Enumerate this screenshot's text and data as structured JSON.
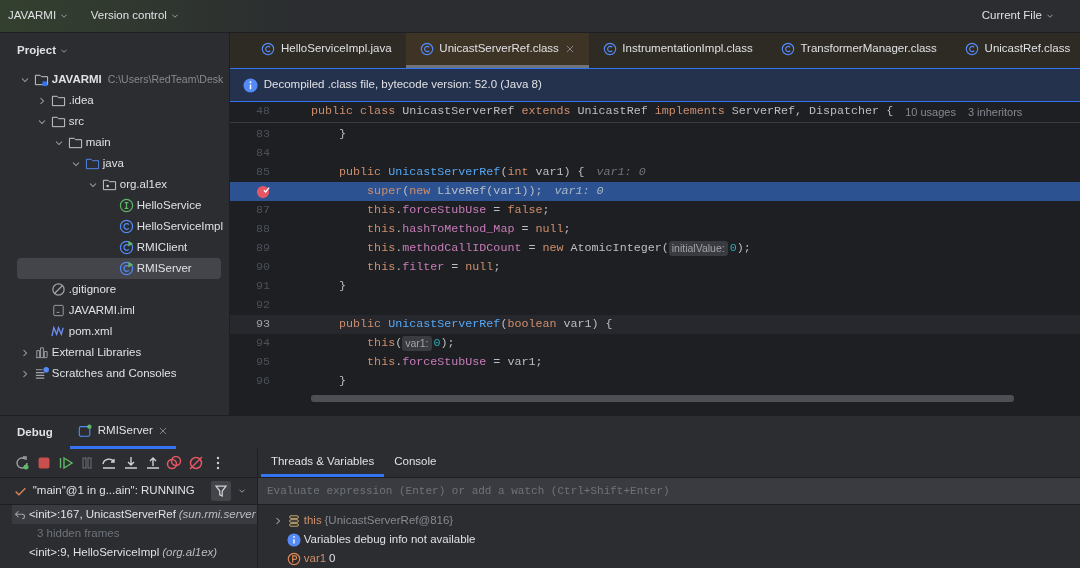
{
  "title_bar": {
    "project": "JAVARMI",
    "vcs": "Version control",
    "run_config": "Current File"
  },
  "project_panel": {
    "title": "Project",
    "tree": [
      {
        "label": "JAVARMI",
        "path": "C:\\Users\\RedTeam\\Desk",
        "kind": "project",
        "expanded": true,
        "selected": false,
        "children": [
          {
            "label": ".idea",
            "kind": "folder",
            "expanded": false,
            "selected": false
          },
          {
            "label": "src",
            "kind": "folder",
            "expanded": true,
            "selected": false,
            "children": [
              {
                "label": "main",
                "kind": "folder",
                "expanded": true,
                "selected": false,
                "children": [
                  {
                    "label": "java",
                    "kind": "source",
                    "expanded": true,
                    "selected": false,
                    "children": [
                      {
                        "label": "org.al1ex",
                        "kind": "package",
                        "expanded": true,
                        "selected": false,
                        "children": [
                          {
                            "label": "HelloService",
                            "kind": "interface",
                            "selected": false
                          },
                          {
                            "label": "HelloServiceImpl",
                            "kind": "class",
                            "selected": false
                          },
                          {
                            "label": "RMIClient",
                            "kind": "runnable",
                            "selected": false
                          },
                          {
                            "label": "RMIServer",
                            "kind": "runnable",
                            "selected": true
                          }
                        ]
                      }
                    ]
                  }
                ]
              }
            ]
          },
          {
            "label": ".gitignore",
            "kind": "ignore",
            "selected": false
          },
          {
            "label": "JAVARMI.iml",
            "kind": "iml",
            "selected": false
          },
          {
            "label": "pom.xml",
            "kind": "maven",
            "selected": false
          }
        ]
      },
      {
        "label": "External Libraries",
        "kind": "libraries",
        "expanded": false,
        "selected": false
      },
      {
        "label": "Scratches and Consoles",
        "kind": "scratches",
        "expanded": false,
        "selected": false
      }
    ]
  },
  "editor_tabs": [
    {
      "label": "HelloServiceImpl.java",
      "selected": false
    },
    {
      "label": "UnicastServerRef.class",
      "selected": true
    },
    {
      "label": "InstrumentationImpl.class",
      "selected": false
    },
    {
      "label": "TransformerManager.class",
      "selected": false
    },
    {
      "label": "UnicastRef.class",
      "selected": false
    }
  ],
  "banner": "Decompiled .class file, bytecode version: 52.0 (Java 8)",
  "sticky_line": {
    "number": "48",
    "parts": [
      {
        "kind": "code",
        "tokens": [
          {
            "text": "public class ",
            "kind": "kw"
          },
          {
            "text": "UnicastServerRef ",
            "kind": "plain"
          },
          {
            "text": "extends ",
            "kind": "kw"
          },
          {
            "text": "UnicastRef ",
            "kind": "plain"
          },
          {
            "text": "implements ",
            "kind": "kw"
          },
          {
            "text": "ServerRef, Dispatcher {",
            "kind": "plain"
          }
        ]
      },
      {
        "kind": "lens",
        "text": "10 usages"
      },
      {
        "kind": "lens",
        "text": "3 inheritors"
      }
    ]
  },
  "code_lines": [
    {
      "number": "83",
      "current": false,
      "caret": false,
      "breakpoint": false,
      "parts": [
        {
          "kind": "code",
          "tokens": [
            {
              "text": "    }",
              "kind": "plain"
            }
          ]
        }
      ]
    },
    {
      "number": "84",
      "current": false,
      "caret": false,
      "breakpoint": false
    },
    {
      "number": "85",
      "current": false,
      "caret": false,
      "breakpoint": false,
      "parts": [
        {
          "kind": "code",
          "tokens": [
            {
              "text": "    public ",
              "kind": "kw"
            },
            {
              "text": "UnicastServerRef",
              "kind": "fn"
            },
            {
              "text": "(",
              "kind": "plain"
            },
            {
              "text": "int ",
              "kind": "kw"
            },
            {
              "text": "var1) {",
              "kind": "plain"
            }
          ]
        },
        {
          "kind": "value",
          "text": "var1: 0"
        }
      ]
    },
    {
      "current": true,
      "caret": false,
      "breakpoint": true,
      "parts": [
        {
          "kind": "code",
          "tokens": [
            {
              "text": "        super",
              "kind": "kw"
            },
            {
              "text": "(",
              "kind": "plain"
            },
            {
              "text": "new ",
              "kind": "kw"
            },
            {
              "text": "LiveRef(var1));",
              "kind": "plain"
            }
          ]
        },
        {
          "kind": "value",
          "text": "var1: 0"
        }
      ]
    },
    {
      "number": "87",
      "current": false,
      "caret": false,
      "breakpoint": false,
      "parts": [
        {
          "kind": "code",
          "tokens": [
            {
              "text": "        this",
              "kind": "kw"
            },
            {
              "text": ".",
              "kind": "plain"
            },
            {
              "text": "forceStubUse",
              "kind": "field"
            },
            {
              "text": " = ",
              "kind": "plain"
            },
            {
              "text": "false",
              "kind": "kw"
            },
            {
              "text": ";",
              "kind": "plain"
            }
          ]
        }
      ]
    },
    {
      "number": "88",
      "current": false,
      "caret": false,
      "breakpoint": false,
      "parts": [
        {
          "kind": "code",
          "tokens": [
            {
              "text": "        this",
              "kind": "kw"
            },
            {
              "text": ".",
              "kind": "plain"
            },
            {
              "text": "hashToMethod_Map",
              "kind": "field"
            },
            {
              "text": " = ",
              "kind": "plain"
            },
            {
              "text": "null",
              "kind": "kw"
            },
            {
              "text": ";",
              "kind": "plain"
            }
          ]
        }
      ]
    },
    {
      "number": "89",
      "current": false,
      "caret": false,
      "breakpoint": false,
      "parts": [
        {
          "kind": "code",
          "tokens": [
            {
              "text": "        this",
              "kind": "kw"
            },
            {
              "text": ".",
              "kind": "plain"
            },
            {
              "text": "methodCallIDCount",
              "kind": "field"
            },
            {
              "text": " = ",
              "kind": "plain"
            },
            {
              "text": "new ",
              "kind": "kw"
            },
            {
              "text": "AtomicInteger(",
              "kind": "plain"
            }
          ]
        },
        {
          "kind": "inlay",
          "text": "initialValue:"
        },
        {
          "kind": "code",
          "tokens": [
            {
              "text": "0",
              "kind": "num"
            },
            {
              "text": ");",
              "kind": "plain"
            }
          ]
        }
      ]
    },
    {
      "number": "90",
      "current": false,
      "caret": false,
      "breakpoint": false,
      "parts": [
        {
          "kind": "code",
          "tokens": [
            {
              "text": "        this",
              "kind": "kw"
            },
            {
              "text": ".",
              "kind": "plain"
            },
            {
              "text": "filter",
              "kind": "field"
            },
            {
              "text": " = ",
              "kind": "plain"
            },
            {
              "text": "null",
              "kind": "kw"
            },
            {
              "text": ";",
              "kind": "plain"
            }
          ]
        }
      ]
    },
    {
      "number": "91",
      "current": false,
      "caret": false,
      "breakpoint": false,
      "parts": [
        {
          "kind": "code",
          "tokens": [
            {
              "text": "    }",
              "kind": "plain"
            }
          ]
        }
      ]
    },
    {
      "number": "92",
      "current": false,
      "caret": false,
      "breakpoint": false
    },
    {
      "number": "93",
      "current": false,
      "caret": true,
      "breakpoint": false,
      "parts": [
        {
          "kind": "code",
          "tokens": [
            {
              "text": "    public ",
              "kind": "kw"
            },
            {
              "text": "UnicastServerRef",
              "kind": "fn"
            },
            {
              "text": "(",
              "kind": "plain"
            },
            {
              "text": "boolean ",
              "kind": "kw"
            },
            {
              "text": "var1) {",
              "kind": "plain"
            }
          ]
        }
      ]
    },
    {
      "number": "94",
      "current": false,
      "caret": false,
      "breakpoint": false,
      "parts": [
        {
          "kind": "code",
          "tokens": [
            {
              "text": "        this",
              "kind": "kw"
            },
            {
              "text": "(",
              "kind": "plain"
            }
          ]
        },
        {
          "kind": "inlay",
          "text": "var1:"
        },
        {
          "kind": "code",
          "tokens": [
            {
              "text": "0",
              "kind": "num"
            },
            {
              "text": ");",
              "kind": "plain"
            }
          ]
        }
      ]
    },
    {
      "number": "95",
      "current": false,
      "caret": false,
      "breakpoint": false,
      "parts": [
        {
          "kind": "code",
          "tokens": [
            {
              "text": "        this",
              "kind": "kw"
            },
            {
              "text": ".",
              "kind": "plain"
            },
            {
              "text": "forceStubUse",
              "kind": "field"
            },
            {
              "text": " = var1;",
              "kind": "plain"
            }
          ]
        }
      ]
    },
    {
      "number": "96",
      "current": false,
      "caret": false,
      "breakpoint": false,
      "parts": [
        {
          "kind": "code",
          "tokens": [
            {
              "text": "    }",
              "kind": "plain"
            }
          ]
        }
      ]
    }
  ],
  "debug": {
    "title": "Debug",
    "session_tab": "RMIServer",
    "tabs": [
      {
        "label": "Threads & Variables",
        "selected": true
      },
      {
        "label": "Console",
        "selected": false
      }
    ],
    "thread": "\"main\"@1 in g...ain\": RUNNING",
    "frames": [
      {
        "kind": "frame",
        "method": "<init>:167, UnicastServerRef",
        "location": "(sun.rmi.server",
        "selected": true
      },
      {
        "kind": "hidden",
        "method": "3 hidden frames",
        "selected": false
      },
      {
        "kind": "frame",
        "method": "<init>:9, HelloServiceImpl",
        "location": "(org.al1ex)",
        "selected": false
      }
    ],
    "evaluate_placeholder": "Evaluate expression (Enter) or add a watch (Ctrl+Shift+Enter)",
    "variables": [
      {
        "kind": "object",
        "name": "this",
        "value": "{UnicastServerRef@816}"
      },
      {
        "kind": "info",
        "name": "Variables debug info not available"
      },
      {
        "kind": "param",
        "name": "var1",
        "value": "0"
      }
    ]
  }
}
